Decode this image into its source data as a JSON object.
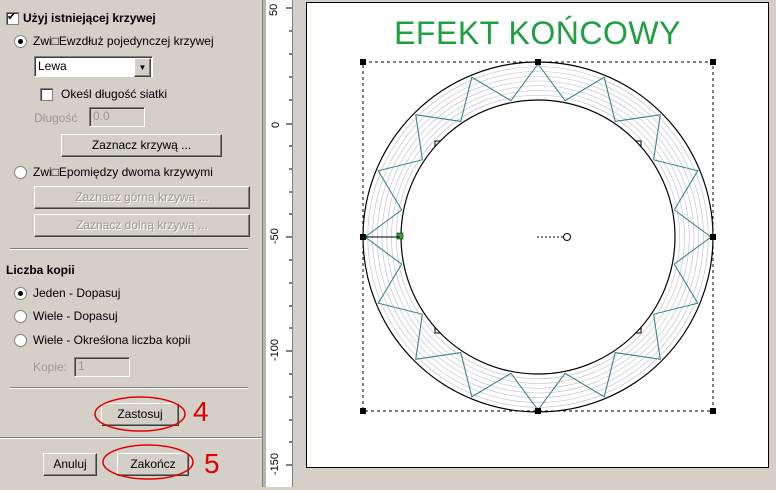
{
  "panel": {
    "use_curve_label": "Użyj istniejącej krzywej",
    "along_single_label": "Zwi□Ewzdłuż pojedynczej krzywej",
    "side_select_value": "Lewa",
    "specify_grid_length_label": "Okeśl długość siatki",
    "length_label": "Długość",
    "length_value": "0.0",
    "select_curve_button": "Zaznacz krzywą ...",
    "between_two_label": "Zwi□Epomiędzy dwoma krzywymi",
    "select_top_curve_button": "Zaznacz górną krzywą ...",
    "select_bottom_curve_button": "Zaznacz dolną krzywą ...",
    "copies_heading": "Liczba kopii",
    "option_one_fit": "Jeden - Dopasuj",
    "option_many_fit": "Wiele - Dopasuj",
    "option_many_count": "Wiele - Okreśłona liczba kopii",
    "copies_label": "Kopie:",
    "copies_value": "1",
    "apply_button": "Zastosuj",
    "cancel_button": "Anuluj",
    "finish_button": "Zakończ"
  },
  "annotations": {
    "step_apply": "4",
    "step_finish": "5"
  },
  "ruler": {
    "labels": [
      "50",
      "0",
      "-50",
      "-100",
      "-150"
    ]
  },
  "canvas": {
    "title": "EFEKT KOŃCOWY"
  },
  "colors": {
    "title": "#1fa040",
    "annotation": "#e00000",
    "ring_teal": "#2a7f80"
  }
}
